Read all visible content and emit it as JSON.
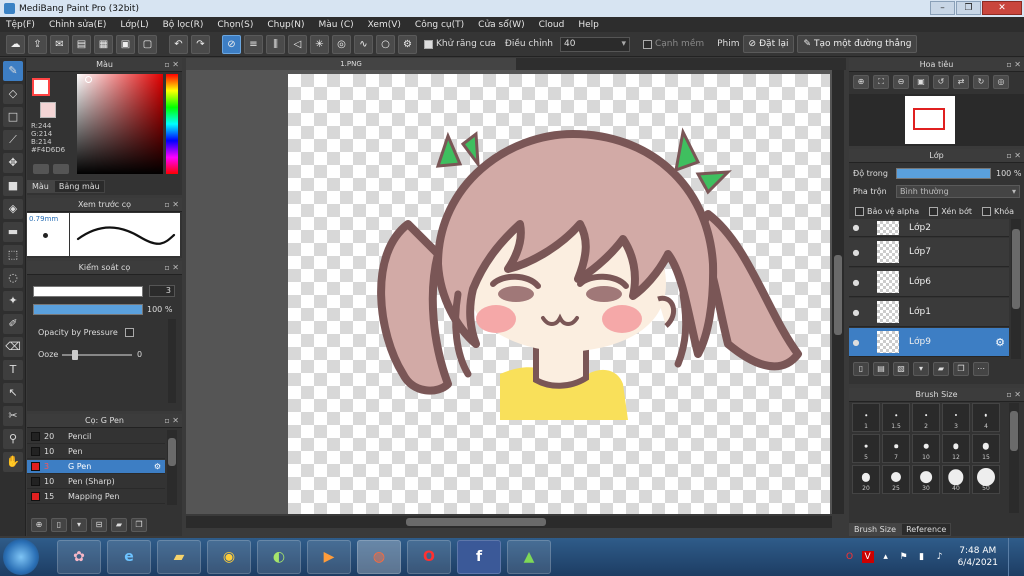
{
  "window": {
    "title": "MediBang Paint Pro (32bit)",
    "controls": {
      "minimize": "–",
      "maximize": "❐",
      "close": "✕"
    }
  },
  "menu": [
    "Tệp(F)",
    "Chỉnh sửa(E)",
    "Lớp(L)",
    "Bộ lọc(R)",
    "Chọn(S)",
    "Chụp(N)",
    "Màu (C)",
    "Xem(V)",
    "Công cụ(T)",
    "Cửa sổ(W)",
    "Cloud",
    "Help"
  ],
  "toolbar": {
    "antialias_label": "Khử răng cưa",
    "antialias_checked": true,
    "correction_label": "Điều chỉnh",
    "correction_value": "40",
    "edge_label": "Cạnh mềm",
    "edge_checked": false,
    "prime_label": "Phim",
    "reset_label": "Đặt lại",
    "create_line_label": "Tạo một đường thẳng"
  },
  "panels": {
    "color": {
      "title": "Màu",
      "fg_color": "#f44444",
      "bg_color": "#f4d6d6",
      "r": "R:244",
      "g": "G:214",
      "b": "B:214",
      "hex": "#F4D6D6",
      "tab_color": "Màu",
      "tab_palette": "Bảng màu"
    },
    "brush_preview": {
      "title": "Xem trước cọ",
      "size_label": "0.79mm"
    },
    "brush_control": {
      "title": "Kiểm soát cọ",
      "size_value": "3",
      "opacity_value": "100 %",
      "opacity_fraction": 1.0,
      "size_fraction": 0.02,
      "opacity_by_pressure_label": "Opacity by Pressure",
      "opacity_by_pressure_checked": false,
      "ooze_label": "Ooze",
      "ooze_value": "0"
    },
    "brush_list": {
      "title": "Cọ: G Pen",
      "items": [
        {
          "num": "20",
          "name": "Pencil",
          "color": "#222222",
          "selected": false
        },
        {
          "num": "10",
          "name": "Pen",
          "color": "#222222",
          "selected": false
        },
        {
          "num": "3",
          "name": "G Pen",
          "color": "#e02020",
          "selected": true
        },
        {
          "num": "10",
          "name": "Pen (Sharp)",
          "color": "#222222",
          "selected": false
        },
        {
          "num": "15",
          "name": "Mapping Pen",
          "color": "#e02020",
          "selected": false
        }
      ]
    },
    "navigator": {
      "title": "Hoa tiêu"
    },
    "layers": {
      "title": "Lớp",
      "opacity_label": "Độ trong",
      "opacity_value": "100 %",
      "blend_label": "Pha trộn",
      "blend_value": "Bình thường",
      "protect_alpha": "Bảo vệ alpha",
      "clipping": "Xén bớt",
      "lock": "Khóa",
      "items": [
        {
          "name": "Lớp2",
          "selected": false
        },
        {
          "name": "Lớp7",
          "selected": false
        },
        {
          "name": "Lớp6",
          "selected": false
        },
        {
          "name": "Lớp1",
          "selected": false
        },
        {
          "name": "Lớp9",
          "selected": true
        }
      ]
    },
    "brush_size": {
      "title": "Brush Size",
      "sizes": [
        "1",
        "1.5",
        "2",
        "3",
        "4",
        "5",
        "7",
        "10",
        "12",
        "15",
        "20",
        "25",
        "30",
        "40",
        "50"
      ],
      "tab_size": "Brush Size",
      "tab_reference": "Reference"
    }
  },
  "document": {
    "tab_title": "1.PNG"
  },
  "taskbar": {
    "time": "7:48 AM",
    "date": "6/4/2021",
    "apps": [
      "paint-app",
      "internet-explorer",
      "file-explorer",
      "chrome",
      "app",
      "media-player",
      "browser",
      "opera",
      "facebook",
      "game"
    ]
  }
}
